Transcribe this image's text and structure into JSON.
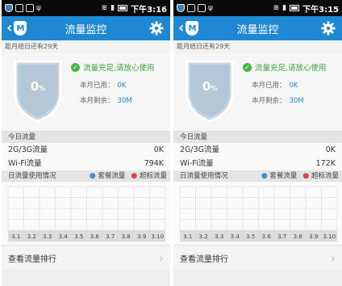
{
  "screens": [
    {
      "status_time": "下午3:16",
      "title": "流量监控",
      "reset_notice": "距月结日还有29天",
      "percent": "0",
      "percent_unit": "%",
      "status_message": "流量充足,请放心使用",
      "used_label": "本月已用：",
      "used_value": "0K",
      "remain_label": "本月剩余：",
      "remain_value": "30M",
      "today_header": "今日流量",
      "mobile_label": "2G/3G流量",
      "mobile_value": "0K",
      "wifi_label": "Wi-Fi流量",
      "wifi_value": "794K",
      "chart_header": "日流量使用情况",
      "legend_plan": "套餐流量",
      "legend_over": "超标流量",
      "rank_label": "查看流量排行"
    },
    {
      "status_time": "下午3:15",
      "title": "流量监控",
      "reset_notice": "距月结日还有29天",
      "percent": "0",
      "percent_unit": "%",
      "status_message": "流量充足,请放心使用",
      "used_label": "本月已用：",
      "used_value": "0K",
      "remain_label": "本月剩余：",
      "remain_value": "30M",
      "today_header": "今日流量",
      "mobile_label": "2G/3G流量",
      "mobile_value": "0K",
      "wifi_label": "Wi-Fi流量",
      "wifi_value": "172K",
      "chart_header": "日流量使用情况",
      "legend_plan": "套餐流量",
      "legend_over": "超标流量",
      "rank_label": "查看流量排行"
    }
  ],
  "chart_data": {
    "type": "bar",
    "categories": [
      "3.1",
      "3.2",
      "3.3",
      "3.4",
      "3.5",
      "3.6",
      "3.7",
      "3.8",
      "3.9",
      "3.10"
    ],
    "series": [
      {
        "name": "套餐流量",
        "values": [
          0,
          0,
          0,
          0,
          0,
          0,
          0,
          0,
          0,
          0
        ]
      },
      {
        "name": "超标流量",
        "values": [
          0,
          0,
          0,
          0,
          0,
          0,
          0,
          0,
          0,
          0
        ]
      }
    ],
    "grid": true,
    "legend": "top-right"
  },
  "colors": {
    "accent": "#1e88d2",
    "ok_green": "#46b446",
    "plan_series": "#3b8fd6",
    "over_series": "#e34040"
  },
  "icons": {
    "back": "chevron-left-icon",
    "app_logo": "shield-logo-icon",
    "settings": "gear-icon",
    "status_ok": "check-circle-icon",
    "more": "chevron-right-icon"
  }
}
